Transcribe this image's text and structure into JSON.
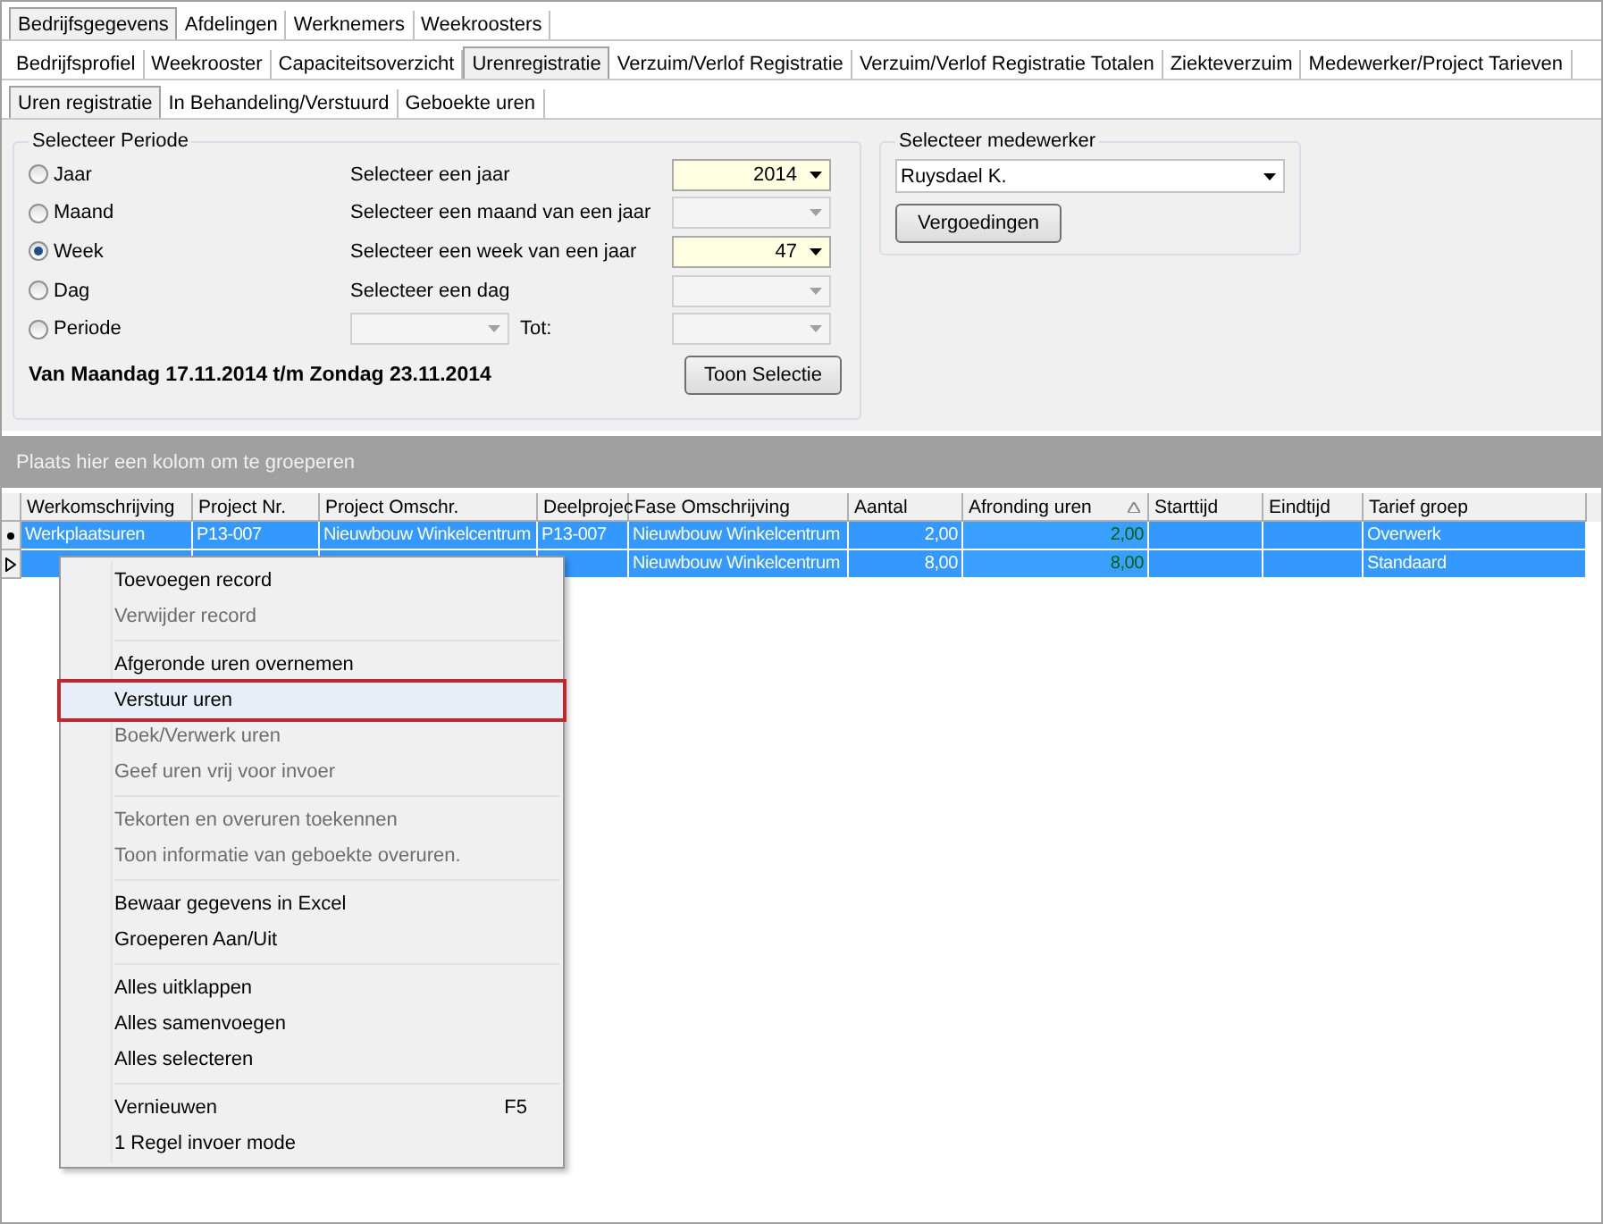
{
  "tabs_level1": [
    {
      "label": "Bedrijfsgegevens",
      "selected": true
    },
    {
      "label": "Afdelingen",
      "selected": false
    },
    {
      "label": "Werknemers",
      "selected": false
    },
    {
      "label": "Weekroosters",
      "selected": false
    }
  ],
  "tabs_level2": [
    {
      "label": "Bedrijfsprofiel",
      "selected": false
    },
    {
      "label": "Weekrooster",
      "selected": false
    },
    {
      "label": "Capaciteitsoverzicht",
      "selected": false
    },
    {
      "label": "Urenregistratie",
      "selected": true
    },
    {
      "label": "Verzuim/Verlof Registratie",
      "selected": false
    },
    {
      "label": "Verzuim/Verlof Registratie Totalen",
      "selected": false
    },
    {
      "label": "Ziekteverzuim",
      "selected": false
    },
    {
      "label": "Medewerker/Project Tarieven",
      "selected": false
    }
  ],
  "tabs_level3": [
    {
      "label": "Uren registratie",
      "selected": true
    },
    {
      "label": "In Behandeling/Verstuurd",
      "selected": false
    },
    {
      "label": "Geboekte uren",
      "selected": false
    }
  ],
  "period_group": {
    "title": "Selecteer Periode",
    "options": [
      {
        "label": "Jaar",
        "selected": false,
        "prompt": "Selecteer een jaar",
        "combo": {
          "value": "2014",
          "disabled": false
        }
      },
      {
        "label": "Maand",
        "selected": false,
        "prompt": "Selecteer een maand van een jaar",
        "combo": {
          "disabled": true
        }
      },
      {
        "label": "Week",
        "selected": true,
        "prompt": "Selecteer een week van een jaar",
        "combo": {
          "value": "47",
          "disabled": false
        }
      },
      {
        "label": "Dag",
        "selected": false,
        "prompt": "Selecteer een dag",
        "combo": {
          "disabled": true
        }
      },
      {
        "label": "Periode",
        "selected": false,
        "from_combo": {
          "disabled": true
        },
        "to_label": "Tot:",
        "combo": {
          "disabled": true
        }
      }
    ],
    "range_text": "Van Maandag 17.11.2014 t/m Zondag 23.11.2014",
    "button": "Toon Selectie"
  },
  "employee_group": {
    "title": "Selecteer medewerker",
    "value": "Ruysdael  K.",
    "button": "Vergoedingen"
  },
  "grid": {
    "group_hint": "Plaats hier een kolom om te groeperen",
    "columns": [
      {
        "label": "Werkomschrijving"
      },
      {
        "label": "Project Nr."
      },
      {
        "label": "Project Omschr."
      },
      {
        "label": "Deelprojec"
      },
      {
        "label": "Fase Omschrijving"
      },
      {
        "label": "Aantal"
      },
      {
        "label": "Afronding uren",
        "sorted": true
      },
      {
        "label": "Starttijd"
      },
      {
        "label": "Eindtijd"
      },
      {
        "label": "Tarief groep"
      }
    ],
    "rows": [
      {
        "kind": "current",
        "selected": true,
        "cells": [
          "Werkplaatsuren",
          "P13-007",
          "Nieuwbouw Winkelcentrum",
          "P13-007",
          "Nieuwbouw Winkelcentrum",
          "2,00",
          "2,00",
          null,
          null,
          "Overwerk"
        ]
      },
      {
        "kind": "edit",
        "selected": true,
        "cells": [
          null,
          null,
          null,
          null,
          "Nieuwbouw Winkelcentrum",
          "8,00",
          "8,00",
          null,
          null,
          "Standaard"
        ]
      }
    ]
  },
  "context_menu": {
    "items": [
      {
        "kind": "item",
        "label": "Toevoegen record",
        "disabled": false,
        "selected": false
      },
      {
        "kind": "item",
        "label": "Verwijder record",
        "disabled": true,
        "selected": false
      },
      {
        "kind": "separator"
      },
      {
        "kind": "item",
        "label": "Afgeronde uren overnemen",
        "disabled": false,
        "selected": false
      },
      {
        "kind": "item",
        "label": "Verstuur uren",
        "disabled": false,
        "selected": true
      },
      {
        "kind": "item",
        "label": "Boek/Verwerk uren",
        "disabled": true,
        "selected": false
      },
      {
        "kind": "item",
        "label": "Geef uren vrij voor invoer",
        "disabled": true,
        "selected": false
      },
      {
        "kind": "separator"
      },
      {
        "kind": "item",
        "label": "Tekorten en overuren toekennen",
        "disabled": true,
        "selected": false
      },
      {
        "kind": "item",
        "label": "Toon informatie van geboekte overuren.",
        "disabled": true,
        "selected": false
      },
      {
        "kind": "separator"
      },
      {
        "kind": "item",
        "label": "Bewaar gegevens in Excel",
        "disabled": false,
        "selected": false
      },
      {
        "kind": "item",
        "label": "Groeperen Aan/Uit",
        "disabled": false,
        "selected": false
      },
      {
        "kind": "separator"
      },
      {
        "kind": "item",
        "label": "Alles uitklappen",
        "disabled": false,
        "selected": false
      },
      {
        "kind": "item",
        "label": "Alles samenvoegen",
        "disabled": false,
        "selected": false
      },
      {
        "kind": "item",
        "label": "Alles selecteren",
        "disabled": false,
        "selected": false
      },
      {
        "kind": "separator"
      },
      {
        "kind": "item",
        "label": "Vernieuwen",
        "shortcut": "F5",
        "disabled": false,
        "selected": false
      },
      {
        "kind": "item",
        "label": "1 Regel invoer mode",
        "disabled": false,
        "selected": false
      }
    ]
  }
}
